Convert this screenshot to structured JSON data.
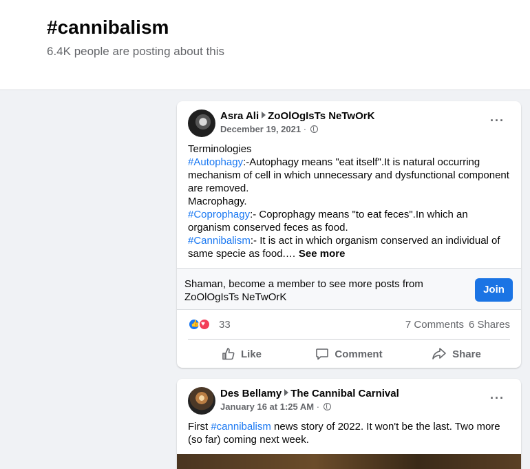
{
  "hashtag": {
    "title": "#cannibalism",
    "subtitle": "6.4K people are posting about this"
  },
  "posts": [
    {
      "author": "Asra Ali",
      "group": "ZoOlOgIsTs NeTwOrK",
      "date": "December 19, 2021",
      "separator": "·",
      "privacy_icon": "globe-icon",
      "text": {
        "l1": "Terminologies",
        "l2_tag": "#Autophagy",
        "l2_rest": ":-Autophagy means \"eat itself\".It is natural occurring mechanism of cell in which unnecessary and dysfunctional component are removed.",
        "l3": "Macrophagy.",
        "l4_tag": "#Coprophagy",
        "l4_rest": ":- Coprophagy means \"to eat feces\".In which an organism conserved feces as food.",
        "l5_tag": "#Cannibalism",
        "l5_rest": ":- It is act in which organism conserved an individual of same specie as food.…",
        "see_more": "See more"
      },
      "join_prompt": "Shaman, become a member to see more posts from ZoOlOgIsTs NeTwOrK",
      "join_label": "Join",
      "reaction_count": "33",
      "comments": "7 Comments",
      "shares": "6 Shares",
      "actions": {
        "like": "Like",
        "comment": "Comment",
        "share": "Share"
      }
    },
    {
      "author": "Des Bellamy",
      "group": "The Cannibal Carnival",
      "date": "January 16 at 1:25 AM",
      "separator": "·",
      "text": {
        "pre": "First ",
        "tag": "#cannibalism",
        "post": " news story of 2022. It won't be the last. Two more (so far) coming next week."
      }
    }
  ],
  "colors": {
    "link": "#1877f2",
    "join_button": "#1b74e4",
    "secondary_text": "#65676b",
    "like_reaction": "#1877f2",
    "love_reaction": "#f33e58"
  }
}
